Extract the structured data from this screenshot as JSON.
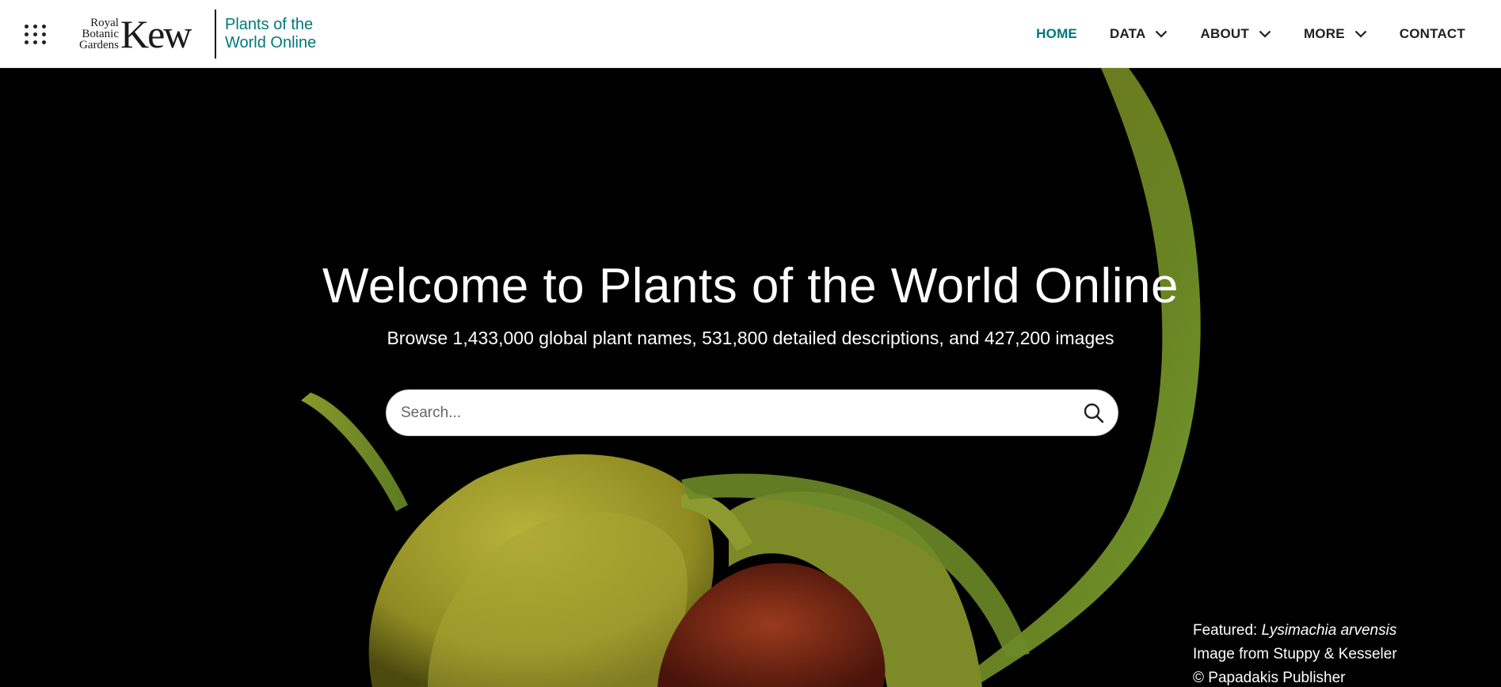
{
  "header": {
    "apps_icon": "grid-icon",
    "logo": {
      "small_lines": [
        "Royal",
        "Botanic",
        "Gardens"
      ],
      "big": "Kew"
    },
    "site_name_line1": "Plants of the",
    "site_name_line2": "World Online",
    "nav": [
      {
        "label": "HOME",
        "active": true,
        "dropdown": false
      },
      {
        "label": "DATA",
        "active": false,
        "dropdown": true
      },
      {
        "label": "ABOUT",
        "active": false,
        "dropdown": true
      },
      {
        "label": "MORE",
        "active": false,
        "dropdown": true
      },
      {
        "label": "CONTACT",
        "active": false,
        "dropdown": false
      }
    ]
  },
  "hero": {
    "title": "Welcome to Plants of the World Online",
    "subtitle": "Browse 1,433,000 global plant names, 531,800 detailed descriptions, and 427,200 images",
    "search": {
      "placeholder": "Search...",
      "value": "",
      "icon": "search-icon"
    },
    "credit": {
      "featured_label": "Featured:",
      "species": "Lysimachia arvensis",
      "image_from": "Image from Stuppy & Kesseler",
      "copyright": "© Papadakis Publisher"
    }
  },
  "colors": {
    "accent": "#00787a",
    "header_bg": "#ffffff",
    "hero_bg": "#000000"
  }
}
